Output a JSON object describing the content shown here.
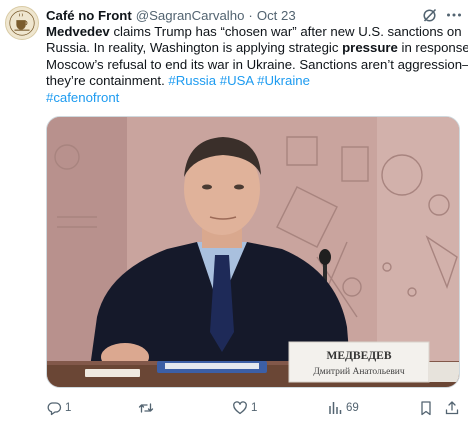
{
  "author": {
    "display_name": "Café no Front",
    "handle": "@SagranCarvalho",
    "separator": "·",
    "time": "Oct 23",
    "avatar_icon": "cafe-logo-icon"
  },
  "tweet": {
    "line1_bold": "Medvedev",
    "line1_rest": " claims Trump has “chosen war” after new U.S. sanctions on",
    "line2": "Russia. In reality, Washington is applying strategic ",
    "line2_bold": "pressure",
    "line2_rest": " in response to",
    "line3": "Moscow’s refusal to end its war in Ukraine. Sanctions aren’t aggression—",
    "line4": "they’re containment. ",
    "hashtags": [
      "#Russia",
      "#USA",
      "#Ukraine",
      "#cafenofront"
    ]
  },
  "media": {
    "nameplate_line1": "МЕДВЕДЕВ",
    "nameplate_line2": "Дмитрий Анатольевич"
  },
  "actions": {
    "reply_count": "1",
    "retweet_count": "",
    "like_count": "1",
    "views_count": "69"
  },
  "colors": {
    "link": "#1d9bf0",
    "muted": "#536471",
    "text": "#0f1419"
  }
}
